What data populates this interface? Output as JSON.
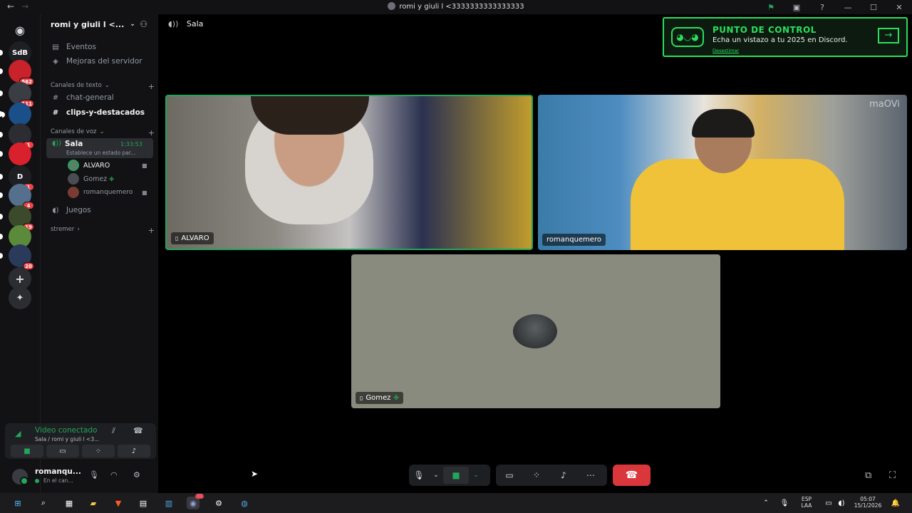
{
  "window": {
    "title": "romi y giuli l <3333333333333333"
  },
  "rail": {
    "home_label": "",
    "servers": [
      {
        "label": "SdB",
        "badge": "",
        "color": "#1e1f22"
      },
      {
        "label": "",
        "badge": "562",
        "color": "#c8222b"
      },
      {
        "label": "",
        "badge": "111",
        "color": "#3b3d44"
      },
      {
        "label": "",
        "badge": "",
        "color": "#1b4f8a"
      },
      {
        "label": "",
        "badge": "1",
        "color": "#2c2d33"
      },
      {
        "label": "",
        "badge": "",
        "color": "#d8212c"
      },
      {
        "label": "D",
        "badge": "1",
        "color": "#1e1f22"
      },
      {
        "label": "",
        "badge": "4",
        "color": "#54708d"
      },
      {
        "label": "",
        "badge": "19",
        "color": "#3a4a2a"
      },
      {
        "label": "",
        "badge": "",
        "color": "#5a8a3a"
      },
      {
        "label": "",
        "badge": "20",
        "color": "#2a3a5a"
      }
    ]
  },
  "sidebar": {
    "server_name": "romi y giuli l <...",
    "items": [
      {
        "label": "Eventos"
      },
      {
        "label": "Mejoras del servidor"
      }
    ],
    "text_category": "Canales de texto",
    "text_channels": [
      {
        "label": "chat-general"
      },
      {
        "label": "clips-y-destacados"
      }
    ],
    "voice_category": "Canales de voz",
    "voice_channel": {
      "name": "Sala",
      "time": "1:33:53",
      "status": "Establece un estado par..."
    },
    "voice_users": [
      {
        "name": "ALVARO"
      },
      {
        "name": "Gomez"
      },
      {
        "name": "romanquemero"
      }
    ],
    "other_voice": "Juegos",
    "streamer_category": "stremer"
  },
  "voice_panel": {
    "title": "Video conectado",
    "subtitle": "Sala / romi y giuli l <3..."
  },
  "user": {
    "name": "romanqu...",
    "status": "En el can..."
  },
  "header": {
    "channel": "Sala"
  },
  "promo": {
    "title": "PUNTO DE CONTROL",
    "subtitle": "Echa un vistazo a tu 2025 en Discord.",
    "dismiss": "Desestimar"
  },
  "tiles": [
    {
      "name": "ALVARO"
    },
    {
      "name": "romanquemero"
    },
    {
      "name": "Gomez"
    }
  ],
  "video_watermark": "maOVi",
  "taskbar": {
    "lang_top": "ESP",
    "lang_bottom": "LAA",
    "time": "05:07",
    "date": "15/1/2026",
    "discord_badge": "31"
  },
  "colors": {
    "accent_green": "#23a55a",
    "promo_green": "#2adf5c",
    "hangup_red": "#da373c"
  }
}
